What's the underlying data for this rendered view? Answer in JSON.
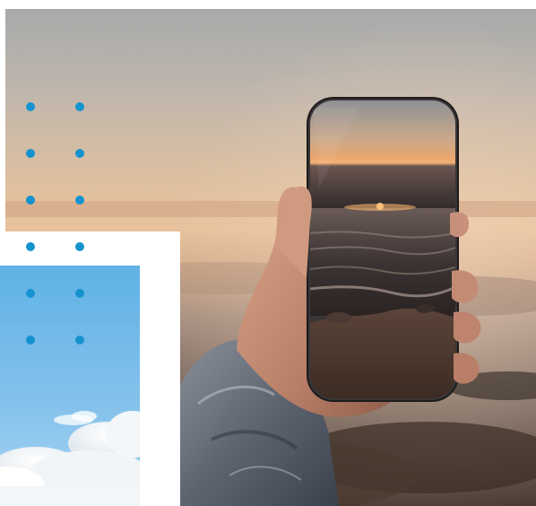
{
  "hero_photo": {
    "subject": "hand-holding-phone-at-sunset"
  },
  "secondary_photo": {
    "subject": "blue-sky-with-clouds"
  },
  "dot_grid": {
    "rows": 6,
    "cols": 2
  },
  "colors": {
    "dot": "#1593cf",
    "sky_top": "#5fb2e6",
    "sky_bottom": "#a9d5f1",
    "sunset_sky_top": "#a6a9a9",
    "sunset_glow": "#e3b98f",
    "sea_dark": "#3a2f2a"
  }
}
